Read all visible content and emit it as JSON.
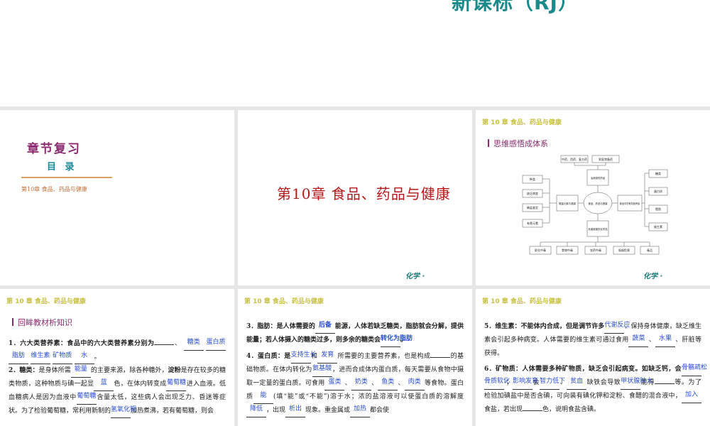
{
  "header": {
    "title": "新课标（RJ）"
  },
  "slide1": {
    "chapter_review": "章节复习",
    "toc": "目 录",
    "toc_link": "第10章 食品、药品与健康"
  },
  "slide2": {
    "chapter_title": "第10章  食品、药品与健康",
    "corner": "化学 ·"
  },
  "slide3": {
    "header": "第 10 章 食品、药品与健康",
    "section": "思维感悟成体系",
    "corner": "化学 ·",
    "mindmap": {
      "center": "食品、药品与健康",
      "top_boxes": [
        "中药、西药、复方药",
        "家庭常备药"
      ],
      "left_boxes": [
        "种类",
        "缺乏病变",
        "碘盐鉴定",
        "有害元素"
      ],
      "mid_left": "微量元素与健康",
      "mid_top": "治病用的药品",
      "mid_bottom": "危害健康的化学品",
      "mid_right": "食品中的有机营养素",
      "right_boxes": [
        "糖类",
        "蛋白质",
        "脂肪",
        "维生素"
      ],
      "bottom_boxes": [
        "职业中毒",
        "食物中毒",
        "农药中毒",
        "吸烟危害",
        "毒品"
      ]
    }
  },
  "slide4": {
    "header": "第 10 章 食品、药品与健康",
    "section": "回眸教材析知识",
    "item1_text": "1．六大类营养素：食品中的六大类营养素分别为",
    "item1_answers": [
      "糖类",
      "蛋白质",
      "脂肪",
      "维生素",
      "矿物质",
      "水"
    ],
    "item2_lead": "2．糖类：",
    "item2_t1": "是身体所需",
    "item2_a1": "能量",
    "item2_t2": "的主要来源，除各种糖外，",
    "item2_t3": "淀粉",
    "item2_t4": "是存在较多的糖类物质，这种物质与碘一起显",
    "item2_a2": "蓝",
    "item2_t5": "色，在体内转变成",
    "item2_a3": "葡萄糖",
    "item2_t6": "进入血液。低血糖病人是因为血液中",
    "item2_a4": "葡萄糖",
    "item2_t7": "含量太低，这些病人会出现乏力、昏迷等症状。为了检验葡萄糖，常利用新制的",
    "item2_a5": "氢氧化铜",
    "item2_t8": "加热煮沸，若有葡萄糖，则会"
  },
  "slide5": {
    "header": "第 10 章 食品、药品与健康",
    "item3_t1": "3．脂肪：是人体需要的",
    "item3_a1": "后备",
    "item3_t2": "能源，人体若缺乏糖类，脂肪就会分解，提供能量；若人体摄入的糖类过多，则多余的糖类会",
    "item3_a2": "转化为脂肪",
    "item3_t3": "。",
    "item4_t1": "4．蛋白质：是",
    "item4_a1": "支持生长",
    "item4_t2": "和",
    "item4_a2": "发育",
    "item4_t3": "所需要的主要营养素，也是构成",
    "item4_t4": "的基础物质。在体内转化为",
    "item4_a3": "氨基酸",
    "item4_t5": "，进而合成体内蛋白质，每天需要从食物中摄取一定量的蛋白质。可食用",
    "item4_a4": "蛋类",
    "item4_t6": "、",
    "item4_a5": "奶类",
    "item4_t7": "、",
    "item4_a6": "鱼类",
    "item4_t8": "、",
    "item4_a7": "肉类",
    "item4_t9": "等食物。蛋白质",
    "item4_a8": "能",
    "item4_t10": "(填“能”或“不能”)溶于水；浓的盐溶液可以使蛋白质的溶解度",
    "item4_a9": "降低",
    "item4_t11": "，出现",
    "item4_a10": "析出",
    "item4_t12": "现象。重金属或",
    "item4_a11": "加热",
    "item4_t13": "都会使"
  },
  "slide6": {
    "header": "第 10 章 食品、药品与健康",
    "item5_t1": "5．维生素：不能体内合成，但是调节许多",
    "item5_a1": "代谢反应",
    "item5_t2": "，保持身体健康，缺乏维生素会引起多种病变。人体需要的维生素可通过食用",
    "item5_a2": "蔬菜",
    "item5_t3": "、",
    "item5_a3": "水果",
    "item5_t4": "、肝脏等获得。",
    "item6_t1": "6．矿物质：人体需要多种矿物质，缺乏会引起病变。如缺乏钙，会",
    "item6_a1": "骨骼疏松",
    "item6_a2": "骨质软化",
    "item6_t2": "-；",
    "item6_a3": "影响发育",
    "item6_t3": "会",
    "item6_a4": "智力低下",
    "item6_t4": "、",
    "item6_a5": "贫血",
    "item6_t5": "缺铁会导致",
    "item6_a6": "甲状腺肿大",
    "item6_t6": "能得",
    "item6_t7": "等。为了检验加碘盐中是否含碘，可向装有碘化钾和淀粉、食醋的混合液中，",
    "item6_a7": "加入",
    "item6_t8": "食盐，若出现",
    "item6_t9": "色，说明食盐含碘。"
  }
}
